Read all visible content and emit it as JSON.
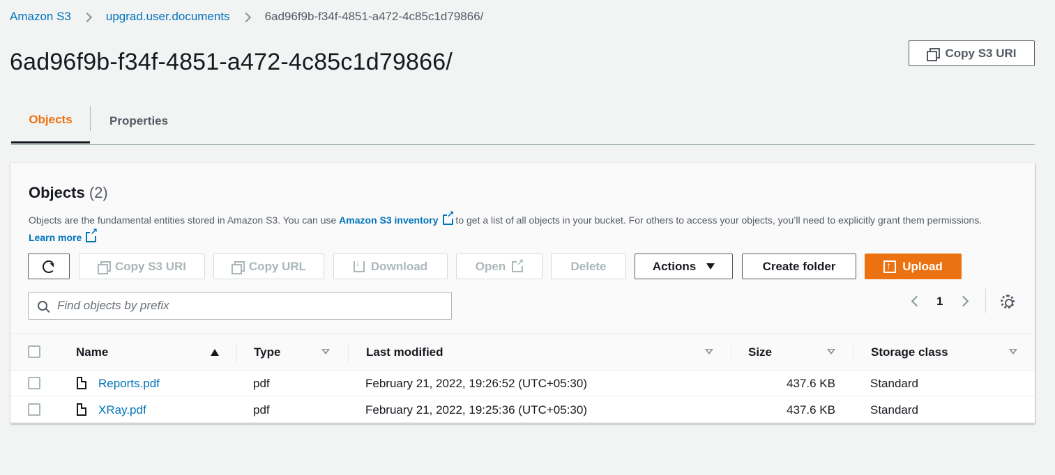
{
  "breadcrumb": {
    "items": [
      "Amazon S3",
      "upgrad.user.documents"
    ],
    "current": "6ad96f9b-f34f-4851-a472-4c85c1d79866/"
  },
  "page": {
    "title": "6ad96f9b-f34f-4851-a472-4c85c1d79866/",
    "copy_uri_label": "Copy S3 URI"
  },
  "tabs": [
    {
      "label": "Objects",
      "active": true
    },
    {
      "label": "Properties",
      "active": false
    }
  ],
  "objects_panel": {
    "title": "Objects",
    "count": "(2)",
    "description": {
      "part1": "Objects are the fundamental entities stored in Amazon S3. You can use ",
      "inventory_link": "Amazon S3 inventory",
      "part2": " to get a list of all objects in your bucket. For others to access your objects, you’ll need to explicitly grant them permissions. ",
      "learn_more": "Learn more"
    },
    "toolbar": {
      "copy_s3_uri": "Copy S3 URI",
      "copy_url": "Copy URL",
      "download": "Download",
      "open": "Open",
      "delete": "Delete",
      "actions": "Actions",
      "create_folder": "Create folder",
      "upload": "Upload"
    },
    "search": {
      "placeholder": "Find objects by prefix",
      "value": ""
    },
    "pagination": {
      "page": "1"
    },
    "columns": [
      "Name",
      "Type",
      "Last modified",
      "Size",
      "Storage class"
    ],
    "rows": [
      {
        "name": "Reports.pdf",
        "type": "pdf",
        "last_modified": "February 21, 2022, 19:26:52 (UTC+05:30)",
        "size": "437.6 KB",
        "storage_class": "Standard"
      },
      {
        "name": "XRay.pdf",
        "type": "pdf",
        "last_modified": "February 21, 2022, 19:25:36 (UTC+05:30)",
        "size": "437.6 KB",
        "storage_class": "Standard"
      }
    ]
  },
  "colors": {
    "accent": "#ec7211",
    "link": "#0073bb",
    "text": "#16191f",
    "muted": "#545b64"
  },
  "icons": [
    "chevron-right-icon",
    "copy-icon",
    "refresh-icon",
    "download-icon",
    "external-link-icon",
    "caret-down-icon",
    "upload-icon",
    "search-icon",
    "chevron-left-icon",
    "gear-icon",
    "sort-ascending-icon",
    "sort-icon",
    "file-icon"
  ]
}
